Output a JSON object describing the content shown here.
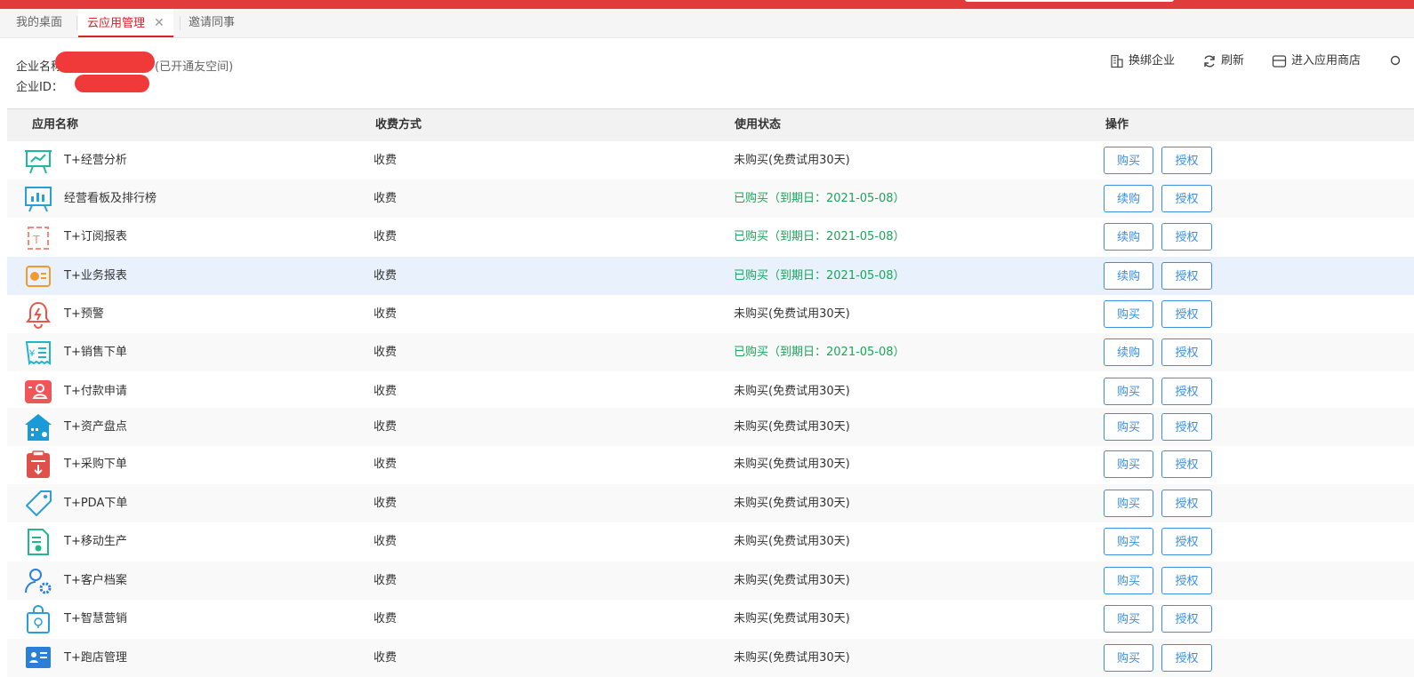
{
  "tabs": [
    {
      "label": "我的桌面",
      "active": false
    },
    {
      "label": "云应用管理",
      "active": true,
      "close": "✕"
    },
    {
      "label": "邀请同事",
      "active": false
    }
  ],
  "company": {
    "name_label": "企业名称",
    "name_suffix": "(已开通友空间)",
    "id_label": "企业ID："
  },
  "toolbar": {
    "switch_label": "换绑企业",
    "refresh_label": "刷新",
    "store_label": "进入应用商店"
  },
  "columns": [
    "应用名称",
    "收费方式",
    "使用状态",
    "操作"
  ],
  "rows": [
    {
      "icon": "presentation-chart-icon",
      "color": "#20b8a0",
      "name": "T+经营分析",
      "fee": "收费",
      "status": "未购买(免费试用30天)",
      "purchased": false,
      "buy": "购买",
      "auth": "授权"
    },
    {
      "icon": "dashboard-board-icon",
      "color": "#2a9fd6",
      "name": "经营看板及排行榜",
      "fee": "收费",
      "status": "已购买（到期日：2021-05-08）",
      "purchased": true,
      "buy": "续购",
      "auth": "授权"
    },
    {
      "icon": "subscription-report-icon",
      "color": "#f08a7a",
      "name": "T+订阅报表",
      "fee": "收费",
      "status": "已购买（到期日：2021-05-08）",
      "purchased": true,
      "buy": "续购",
      "auth": "授权"
    },
    {
      "icon": "business-report-icon",
      "color": "#f29a2e",
      "name": "T+业务报表",
      "fee": "收费",
      "status": "已购买（到期日：2021-05-08）",
      "purchased": true,
      "buy": "续购",
      "auth": "授权"
    },
    {
      "icon": "alarm-bell-icon",
      "color": "#e9554a",
      "name": "T+预警",
      "fee": "收费",
      "status": "未购买(免费试用30天)",
      "purchased": false,
      "buy": "购买",
      "auth": "授权"
    },
    {
      "icon": "sales-order-icon",
      "color": "#1fb6c8",
      "name": "T+销售下单",
      "fee": "收费",
      "status": "已购买（到期日：2021-05-08）",
      "purchased": true,
      "buy": "续购",
      "auth": "授权"
    },
    {
      "icon": "payment-request-icon",
      "color": "#f0555a",
      "name": "T+付款申请",
      "fee": "收费",
      "status": "未购买(免费试用30天)",
      "purchased": false,
      "buy": "购买",
      "auth": "授权"
    },
    {
      "icon": "asset-inventory-icon",
      "color": "#1a9ad6",
      "name": "T+资产盘点",
      "fee": "收费",
      "status": "未购买(免费试用30天)",
      "purchased": false,
      "buy": "购买",
      "auth": "授权"
    },
    {
      "icon": "purchase-order-icon",
      "color": "#e0504a",
      "name": "T+采购下单",
      "fee": "收费",
      "status": "未购买(免费试用30天)",
      "purchased": false,
      "buy": "购买",
      "auth": "授权"
    },
    {
      "icon": "pda-tag-icon",
      "color": "#2a9fd6",
      "name": "T+PDA下单",
      "fee": "收费",
      "status": "未购买(免费试用30天)",
      "purchased": false,
      "buy": "购买",
      "auth": "授权"
    },
    {
      "icon": "mobile-production-icon",
      "color": "#20b88a",
      "name": "T+移动生产",
      "fee": "收费",
      "status": "未购买(免费试用30天)",
      "purchased": false,
      "buy": "购买",
      "auth": "授权"
    },
    {
      "icon": "customer-profile-icon",
      "color": "#2a7fd6",
      "name": "T+客户档案",
      "fee": "收费",
      "status": "未购买(免费试用30天)",
      "purchased": false,
      "buy": "购买",
      "auth": "授权"
    },
    {
      "icon": "smart-marketing-icon",
      "color": "#2a9fd6",
      "name": "T+智慧营销",
      "fee": "收费",
      "status": "未购买(免费试用30天)",
      "purchased": false,
      "buy": "购买",
      "auth": "授权"
    },
    {
      "icon": "store-visit-icon",
      "color": "#2a7fd6",
      "name": "T+跑店管理",
      "fee": "收费",
      "status": "未购买(免费试用30天)",
      "purchased": false,
      "buy": "购买",
      "auth": "授权"
    }
  ]
}
